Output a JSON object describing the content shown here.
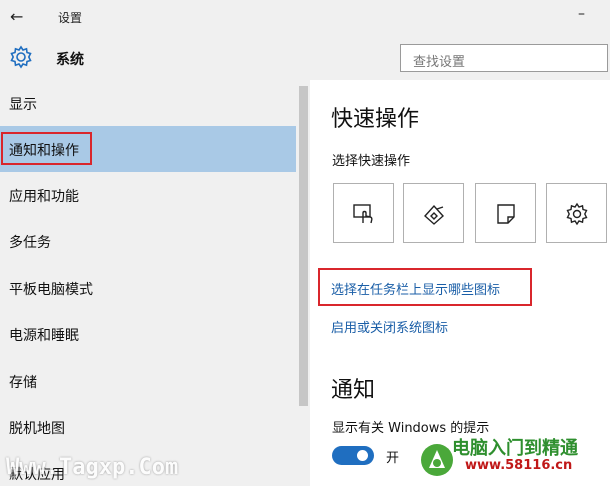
{
  "window": {
    "back_icon": "←",
    "title": "设置",
    "minimize_label": "–"
  },
  "header": {
    "app_icon": "gear-icon",
    "app_title": "系统",
    "search_placeholder": "查找设置"
  },
  "sidebar": {
    "items": [
      {
        "label": "显示",
        "selected": false
      },
      {
        "label": "通知和操作",
        "selected": true
      },
      {
        "label": "应用和功能",
        "selected": false
      },
      {
        "label": "多任务",
        "selected": false
      },
      {
        "label": "平板电脑模式",
        "selected": false
      },
      {
        "label": "电源和睡眠",
        "selected": false
      },
      {
        "label": "存储",
        "selected": false
      },
      {
        "label": "脱机地图",
        "selected": false
      },
      {
        "label": "默认应用",
        "selected": false
      }
    ]
  },
  "main": {
    "quick_title": "快速操作",
    "quick_sub": "选择快速操作",
    "tiles": [
      {
        "icon": "tablet-mode-icon"
      },
      {
        "icon": "connect-icon"
      },
      {
        "icon": "note-icon"
      },
      {
        "icon": "settings-gear-icon"
      }
    ],
    "link_taskbar_icons": "选择在任务栏上显示哪些图标",
    "link_system_icons": "启用或关闭系统图标",
    "notify_title": "通知",
    "notify_sub": "显示有关 Windows 的提示",
    "toggle_state": "开"
  },
  "watermarks": {
    "left": "Www.Tagxp.Com",
    "right_title": "电脑入门到精通",
    "right_url": "www.58116.cn"
  },
  "colors": {
    "selected_bg": "#a9c9e6",
    "link": "#1a5ea7",
    "highlight_border": "#d9262c",
    "toggle_on": "#1f6ec0"
  }
}
